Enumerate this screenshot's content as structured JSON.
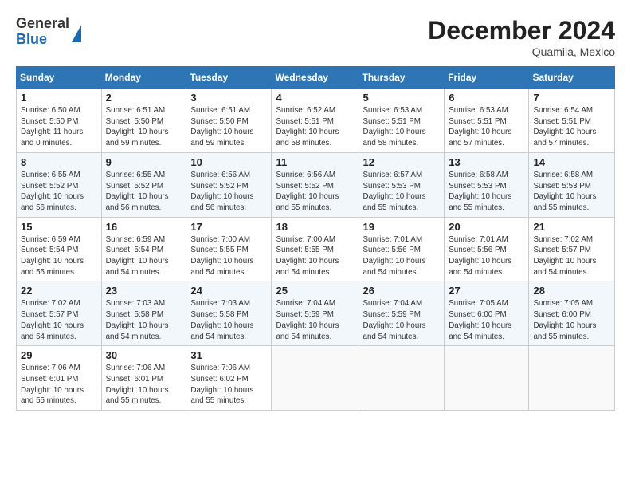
{
  "header": {
    "logo_general": "General",
    "logo_blue": "Blue",
    "month_title": "December 2024",
    "location": "Quamila, Mexico"
  },
  "weekdays": [
    "Sunday",
    "Monday",
    "Tuesday",
    "Wednesday",
    "Thursday",
    "Friday",
    "Saturday"
  ],
  "weeks": [
    [
      {
        "day": "1",
        "info": "Sunrise: 6:50 AM\nSunset: 5:50 PM\nDaylight: 11 hours\nand 0 minutes."
      },
      {
        "day": "2",
        "info": "Sunrise: 6:51 AM\nSunset: 5:50 PM\nDaylight: 10 hours\nand 59 minutes."
      },
      {
        "day": "3",
        "info": "Sunrise: 6:51 AM\nSunset: 5:50 PM\nDaylight: 10 hours\nand 59 minutes."
      },
      {
        "day": "4",
        "info": "Sunrise: 6:52 AM\nSunset: 5:51 PM\nDaylight: 10 hours\nand 58 minutes."
      },
      {
        "day": "5",
        "info": "Sunrise: 6:53 AM\nSunset: 5:51 PM\nDaylight: 10 hours\nand 58 minutes."
      },
      {
        "day": "6",
        "info": "Sunrise: 6:53 AM\nSunset: 5:51 PM\nDaylight: 10 hours\nand 57 minutes."
      },
      {
        "day": "7",
        "info": "Sunrise: 6:54 AM\nSunset: 5:51 PM\nDaylight: 10 hours\nand 57 minutes."
      }
    ],
    [
      {
        "day": "8",
        "info": "Sunrise: 6:55 AM\nSunset: 5:52 PM\nDaylight: 10 hours\nand 56 minutes."
      },
      {
        "day": "9",
        "info": "Sunrise: 6:55 AM\nSunset: 5:52 PM\nDaylight: 10 hours\nand 56 minutes."
      },
      {
        "day": "10",
        "info": "Sunrise: 6:56 AM\nSunset: 5:52 PM\nDaylight: 10 hours\nand 56 minutes."
      },
      {
        "day": "11",
        "info": "Sunrise: 6:56 AM\nSunset: 5:52 PM\nDaylight: 10 hours\nand 55 minutes."
      },
      {
        "day": "12",
        "info": "Sunrise: 6:57 AM\nSunset: 5:53 PM\nDaylight: 10 hours\nand 55 minutes."
      },
      {
        "day": "13",
        "info": "Sunrise: 6:58 AM\nSunset: 5:53 PM\nDaylight: 10 hours\nand 55 minutes."
      },
      {
        "day": "14",
        "info": "Sunrise: 6:58 AM\nSunset: 5:53 PM\nDaylight: 10 hours\nand 55 minutes."
      }
    ],
    [
      {
        "day": "15",
        "info": "Sunrise: 6:59 AM\nSunset: 5:54 PM\nDaylight: 10 hours\nand 55 minutes."
      },
      {
        "day": "16",
        "info": "Sunrise: 6:59 AM\nSunset: 5:54 PM\nDaylight: 10 hours\nand 54 minutes."
      },
      {
        "day": "17",
        "info": "Sunrise: 7:00 AM\nSunset: 5:55 PM\nDaylight: 10 hours\nand 54 minutes."
      },
      {
        "day": "18",
        "info": "Sunrise: 7:00 AM\nSunset: 5:55 PM\nDaylight: 10 hours\nand 54 minutes."
      },
      {
        "day": "19",
        "info": "Sunrise: 7:01 AM\nSunset: 5:56 PM\nDaylight: 10 hours\nand 54 minutes."
      },
      {
        "day": "20",
        "info": "Sunrise: 7:01 AM\nSunset: 5:56 PM\nDaylight: 10 hours\nand 54 minutes."
      },
      {
        "day": "21",
        "info": "Sunrise: 7:02 AM\nSunset: 5:57 PM\nDaylight: 10 hours\nand 54 minutes."
      }
    ],
    [
      {
        "day": "22",
        "info": "Sunrise: 7:02 AM\nSunset: 5:57 PM\nDaylight: 10 hours\nand 54 minutes."
      },
      {
        "day": "23",
        "info": "Sunrise: 7:03 AM\nSunset: 5:58 PM\nDaylight: 10 hours\nand 54 minutes."
      },
      {
        "day": "24",
        "info": "Sunrise: 7:03 AM\nSunset: 5:58 PM\nDaylight: 10 hours\nand 54 minutes."
      },
      {
        "day": "25",
        "info": "Sunrise: 7:04 AM\nSunset: 5:59 PM\nDaylight: 10 hours\nand 54 minutes."
      },
      {
        "day": "26",
        "info": "Sunrise: 7:04 AM\nSunset: 5:59 PM\nDaylight: 10 hours\nand 54 minutes."
      },
      {
        "day": "27",
        "info": "Sunrise: 7:05 AM\nSunset: 6:00 PM\nDaylight: 10 hours\nand 54 minutes."
      },
      {
        "day": "28",
        "info": "Sunrise: 7:05 AM\nSunset: 6:00 PM\nDaylight: 10 hours\nand 55 minutes."
      }
    ],
    [
      {
        "day": "29",
        "info": "Sunrise: 7:06 AM\nSunset: 6:01 PM\nDaylight: 10 hours\nand 55 minutes."
      },
      {
        "day": "30",
        "info": "Sunrise: 7:06 AM\nSunset: 6:01 PM\nDaylight: 10 hours\nand 55 minutes."
      },
      {
        "day": "31",
        "info": "Sunrise: 7:06 AM\nSunset: 6:02 PM\nDaylight: 10 hours\nand 55 minutes."
      },
      {
        "day": "",
        "info": ""
      },
      {
        "day": "",
        "info": ""
      },
      {
        "day": "",
        "info": ""
      },
      {
        "day": "",
        "info": ""
      }
    ]
  ]
}
